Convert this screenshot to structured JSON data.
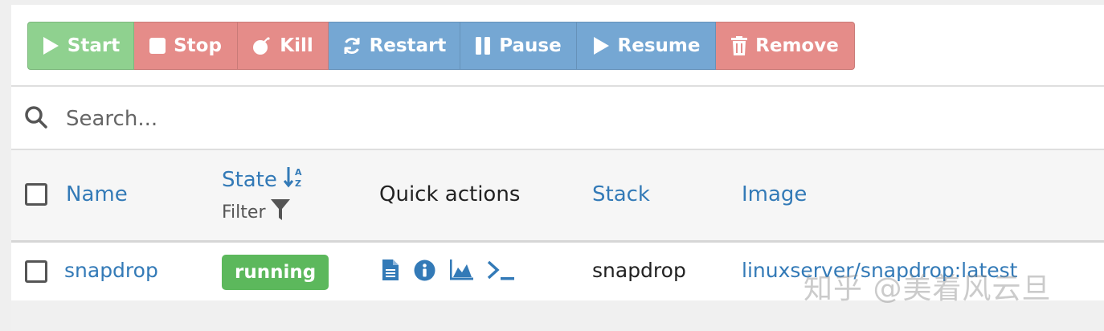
{
  "toolbar": {
    "start_label": "Start",
    "stop_label": "Stop",
    "kill_label": "Kill",
    "restart_label": "Restart",
    "pause_label": "Pause",
    "resume_label": "Resume",
    "remove_label": "Remove"
  },
  "search": {
    "placeholder": "Search..."
  },
  "table": {
    "headers": {
      "name": "Name",
      "state": "State",
      "state_filter": "Filter",
      "quick_actions": "Quick actions",
      "stack": "Stack",
      "image": "Image"
    },
    "rows": [
      {
        "name": "snapdrop",
        "state": "running",
        "stack": "snapdrop",
        "image": "linuxserver/snapdrop:latest"
      }
    ]
  },
  "watermark": "知乎 @美着风云旦",
  "colors": {
    "start": "#8fd18f",
    "danger": "#e58c89",
    "primary": "#75a7d3",
    "link": "#337ab7",
    "running": "#5cb85c"
  },
  "icons": [
    "play-icon",
    "stop-icon",
    "bomb-icon",
    "refresh-icon",
    "pause-icon",
    "trash-icon",
    "search-icon",
    "sort-icon",
    "filter-icon",
    "file-icon",
    "info-icon",
    "chart-icon",
    "terminal-icon"
  ]
}
